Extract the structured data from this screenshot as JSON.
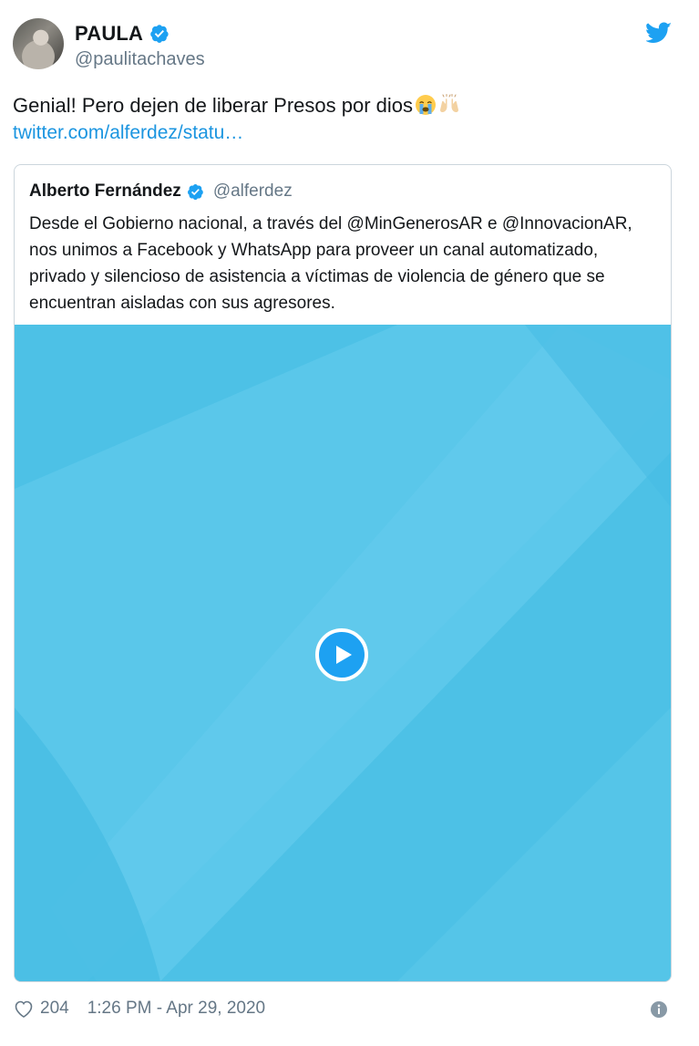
{
  "tweet": {
    "display_name": "PAULA",
    "handle": "@paulitachaves",
    "text": "Genial! Pero dejen de liberar Presos por dios",
    "link": "twitter.com/alferdez/statu…",
    "emojis": [
      "crying-face",
      "raising-hands"
    ],
    "icons": {
      "verified": "verified-badge-icon",
      "logo": "twitter-bird-icon"
    },
    "colors": {
      "accent": "#1da1f2",
      "link": "#1b95e0",
      "muted": "#657786"
    }
  },
  "quoted_tweet": {
    "display_name": "Alberto Fernández",
    "handle": "@alferdez",
    "text": "Desde el Gobierno nacional, a través del @MinGenerosAR e @InnovacionAR, nos unimos a Facebook y WhatsApp para proveer un canal automatizado, privado y silencioso de asistencia a víctimas de violencia de género que se encuentran aisladas con sus agresores.",
    "media": {
      "type": "video",
      "background": "#4dc1e6",
      "icon": "play-icon"
    }
  },
  "footer": {
    "likes": "204",
    "timestamp": "1:26 PM - Apr 29, 2020",
    "icons": {
      "like": "heart-icon",
      "info": "info-icon"
    }
  }
}
